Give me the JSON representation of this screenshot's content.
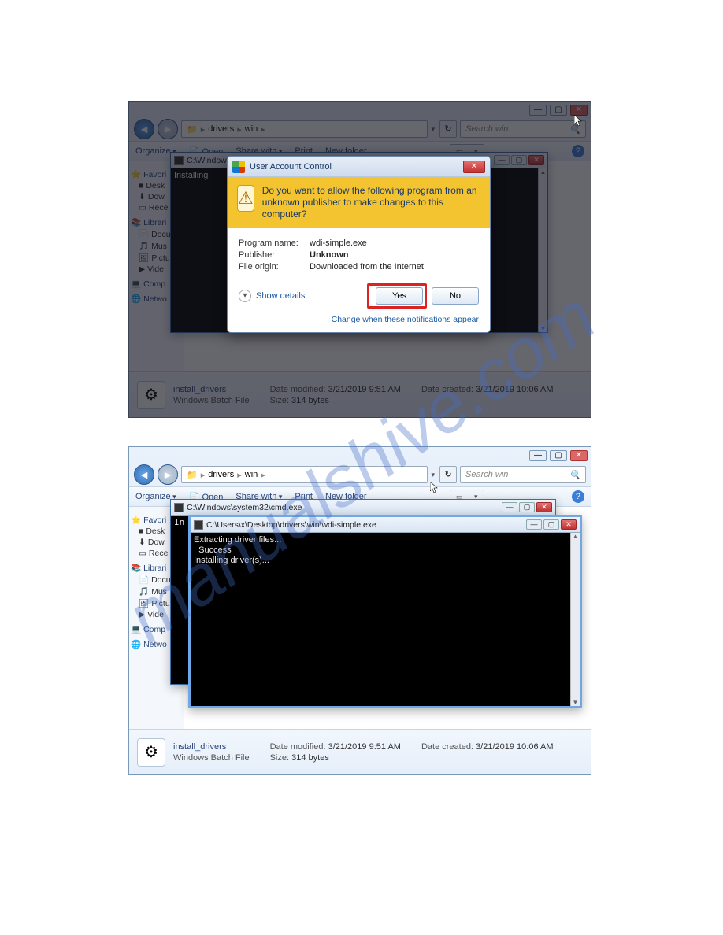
{
  "watermark": "manualshive.com",
  "explorer": {
    "breadcrumb": {
      "seg1": "drivers",
      "seg2": "win"
    },
    "search_placeholder": "Search win",
    "toolbar": {
      "organize": "Organize",
      "open": "Open",
      "share": "Share with",
      "print": "Print",
      "newfolder": "New folder"
    },
    "sidebar": {
      "favorites": "Favori",
      "desktop": "Desk",
      "downloads": "Dow",
      "recent": "Rece",
      "libraries": "Librari",
      "documents": "Docu",
      "music": "Mus",
      "pictures": "Pictu",
      "videos": "Vide",
      "computer": "Comp",
      "network": "Netwo"
    },
    "details": {
      "filename": "install_drivers",
      "filetype": "Windows Batch File",
      "date_modified_label": "Date modified:",
      "date_modified": "3/21/2019 9:51 AM",
      "size_label": "Size:",
      "size": "314 bytes",
      "date_created_label": "Date created:",
      "date_created": "3/21/2019 10:06 AM"
    }
  },
  "uac": {
    "title": "User Account Control",
    "question": "Do you want to allow the following program from an unknown publisher to make changes to this computer?",
    "program_name_label": "Program name:",
    "program_name": "wdi-simple.exe",
    "publisher_label": "Publisher:",
    "publisher": "Unknown",
    "file_origin_label": "File origin:",
    "file_origin": "Downloaded from the Internet",
    "show_details": "Show details",
    "yes": "Yes",
    "no": "No",
    "change_link": "Change when these notifications appear"
  },
  "cmd1": {
    "title": "C:\\Windows\\system32\\cmd.exe",
    "line1": "Installing"
  },
  "cmd2": {
    "title": "C:\\Users\\x\\Desktop\\drivers\\win\\wdi-simple.exe",
    "line1": "Extracting driver files...",
    "line2": "  Success",
    "line3": "Installing driver(s)..."
  }
}
